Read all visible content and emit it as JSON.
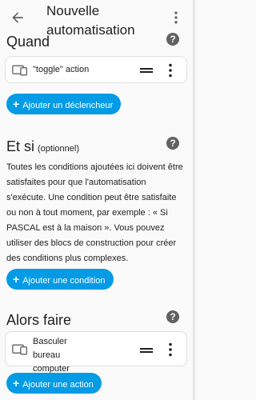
{
  "header": {
    "title": "Nouvelle automatisation",
    "back_icon": "arrow-left-icon",
    "menu_icon": "more-vert-icon"
  },
  "colors": {
    "accent": "#039be5",
    "background": "#fafafa",
    "help_icon": "#616161"
  },
  "triggers": {
    "title": "Quand",
    "items": [
      {
        "label": "\"toggle\" action",
        "icon": "device-icon"
      }
    ],
    "add_label": "Ajouter un déclencheur"
  },
  "conditions": {
    "title": "Et si",
    "optional": "(optionnel)",
    "description": "Toutes les conditions ajoutées ici doivent être satisfaites pour que l'automatisation s'exécute. Une condition peut être satisfaite ou non à tout moment, par exemple : « Si PASCAL est à la maison ». Vous pouvez utiliser des blocs de construction pour créer des conditions plus complexes.",
    "add_label": "Ajouter une condition"
  },
  "actions": {
    "title": "Alors faire",
    "items": [
      {
        "label": "Basculer bureau computer",
        "icon": "device-icon"
      }
    ],
    "add_label": "Ajouter une action"
  }
}
